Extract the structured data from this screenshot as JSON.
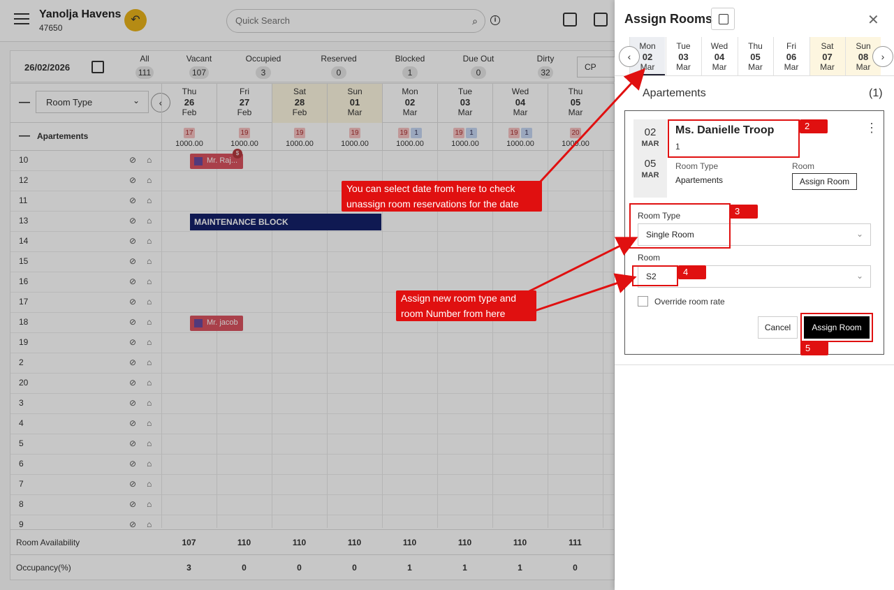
{
  "app": {
    "property_name": "Yanolja Havens",
    "property_id": "47650",
    "search_placeholder": "Quick Search"
  },
  "summary": {
    "date": "26/02/2026",
    "stats": [
      {
        "label": "All",
        "count": "111"
      },
      {
        "label": "Vacant",
        "count": "107"
      },
      {
        "label": "Occupied",
        "count": "3"
      },
      {
        "label": "Reserved",
        "count": "0"
      },
      {
        "label": "Blocked",
        "count": "1"
      },
      {
        "label": "Due Out",
        "count": "0"
      },
      {
        "label": "Dirty",
        "count": "32"
      }
    ],
    "rate_plan": "CP"
  },
  "grid": {
    "room_type_label": "Room Type",
    "days": [
      {
        "dow": "Thu",
        "num": "26",
        "mon": "Feb",
        "weekend": false
      },
      {
        "dow": "Fri",
        "num": "27",
        "mon": "Feb",
        "weekend": false
      },
      {
        "dow": "Sat",
        "num": "28",
        "mon": "Feb",
        "weekend": true
      },
      {
        "dow": "Sun",
        "num": "01",
        "mon": "Mar",
        "weekend": true
      },
      {
        "dow": "Mon",
        "num": "02",
        "mon": "Mar",
        "weekend": false
      },
      {
        "dow": "Tue",
        "num": "03",
        "mon": "Mar",
        "weekend": false
      },
      {
        "dow": "Wed",
        "num": "04",
        "mon": "Mar",
        "weekend": false
      },
      {
        "dow": "Thu",
        "num": "05",
        "mon": "Mar",
        "weekend": false
      }
    ],
    "group_name": "Apartements",
    "availability": [
      {
        "red": "17",
        "blue": "",
        "rate": "1000.00"
      },
      {
        "red": "19",
        "blue": "",
        "rate": "1000.00"
      },
      {
        "red": "19",
        "blue": "",
        "rate": "1000.00"
      },
      {
        "red": "19",
        "blue": "",
        "rate": "1000.00"
      },
      {
        "red": "19",
        "blue": "1",
        "rate": "1000.00"
      },
      {
        "red": "19",
        "blue": "1",
        "rate": "1000.00"
      },
      {
        "red": "19",
        "blue": "1",
        "rate": "1000.00"
      },
      {
        "red": "20",
        "blue": "",
        "rate": "1000.00"
      }
    ],
    "rooms": [
      "10",
      "12",
      "11",
      "13",
      "14",
      "15",
      "16",
      "17",
      "18",
      "19",
      "2",
      "20",
      "3",
      "4",
      "5",
      "6",
      "7",
      "8",
      "9"
    ],
    "reservations": [
      {
        "guest": "Mr. Raj...",
        "badge": "$"
      },
      {
        "guest": "Mr. jacob",
        "badge": ""
      }
    ],
    "maintenance_label": "MAINTENANCE BLOCK",
    "footer": [
      {
        "label": "Room Availability",
        "values": [
          "107",
          "110",
          "110",
          "110",
          "110",
          "110",
          "110",
          "111"
        ]
      },
      {
        "label": "Occupancy(%)",
        "values": [
          "3",
          "0",
          "0",
          "0",
          "1",
          "1",
          "1",
          "0"
        ]
      }
    ]
  },
  "drawer": {
    "title": "Assign Rooms",
    "dates": [
      {
        "dow": "Mon",
        "num": "02",
        "mon": "Mar",
        "weekend": false,
        "selected": true
      },
      {
        "dow": "Tue",
        "num": "03",
        "mon": "Mar",
        "weekend": false,
        "selected": false
      },
      {
        "dow": "Wed",
        "num": "04",
        "mon": "Mar",
        "weekend": false,
        "selected": false
      },
      {
        "dow": "Thu",
        "num": "05",
        "mon": "Mar",
        "weekend": false,
        "selected": false
      },
      {
        "dow": "Fri",
        "num": "06",
        "mon": "Mar",
        "weekend": false,
        "selected": false
      },
      {
        "dow": "Sat",
        "num": "07",
        "mon": "Mar",
        "weekend": true,
        "selected": false
      },
      {
        "dow": "Sun",
        "num": "08",
        "mon": "Mar",
        "weekend": true,
        "selected": false
      }
    ],
    "group_name": "Apartements",
    "group_count": "(1)",
    "card": {
      "from_day": "02",
      "from_mon": "MAR",
      "to_day": "05",
      "to_mon": "MAR",
      "guest": "Ms. Danielle Troop",
      "sub": "1",
      "room_type_label": "Room Type",
      "room_type_value": "Apartements",
      "room_label": "Room",
      "assign_small_label": "Assign Room",
      "form_room_type_label": "Room Type",
      "form_room_type_value": "Single Room",
      "form_room_label": "Room",
      "form_room_value": "S2",
      "override_label": "Override room rate",
      "cancel_label": "Cancel",
      "assign_label": "Assign Room"
    }
  },
  "annotations": {
    "callout_date": [
      "You can select date from here to check",
      "unassign room reservations for the date"
    ],
    "callout_assign": [
      "Assign new room type and",
      "room Number from here"
    ],
    "tags": [
      "2",
      "3",
      "4",
      "5"
    ],
    "color": "#e01010"
  }
}
